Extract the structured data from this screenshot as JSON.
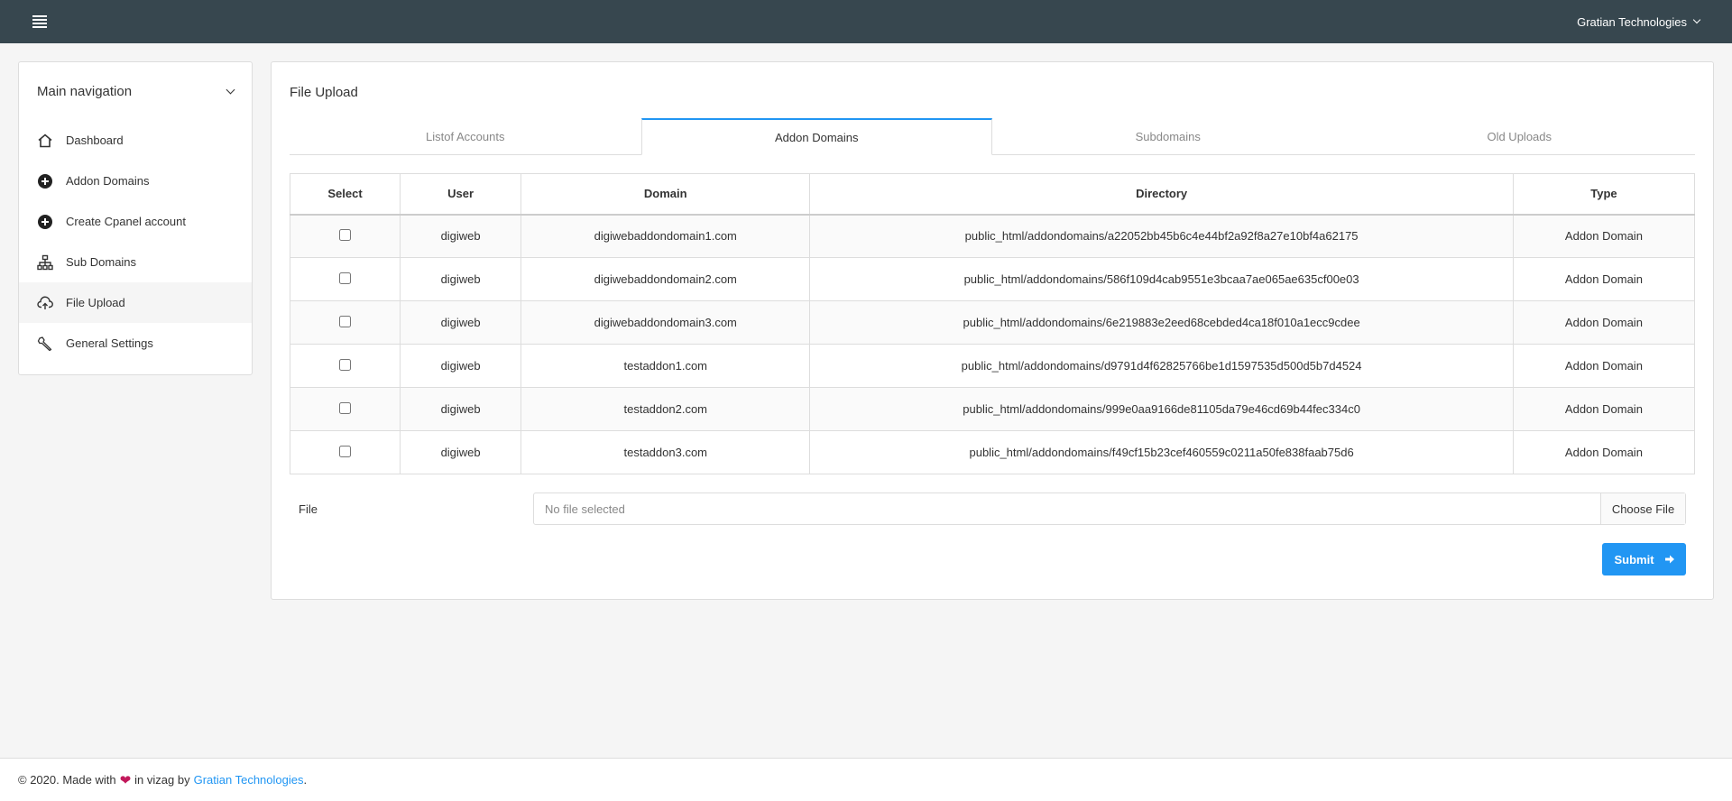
{
  "navbar": {
    "user_name": "Gratian Technologies"
  },
  "sidebar": {
    "header": "Main navigation",
    "items": [
      {
        "label": "Dashboard",
        "icon": "home-icon"
      },
      {
        "label": "Addon Domains",
        "icon": "plus-circle-icon"
      },
      {
        "label": "Create Cpanel account",
        "icon": "plus-circle-icon"
      },
      {
        "label": "Sub Domains",
        "icon": "sitemap-icon"
      },
      {
        "label": "File Upload",
        "icon": "cloud-upload-icon",
        "active": true
      },
      {
        "label": "General Settings",
        "icon": "wrench-icon"
      }
    ]
  },
  "main": {
    "title": "File Upload",
    "tabs": [
      {
        "label": "Listof Accounts"
      },
      {
        "label": "Addon Domains",
        "active": true
      },
      {
        "label": "Subdomains"
      },
      {
        "label": "Old Uploads"
      }
    ],
    "table": {
      "headers": [
        "Select",
        "User",
        "Domain",
        "Directory",
        "Type"
      ],
      "rows": [
        {
          "user": "digiweb",
          "domain": "digiwebaddondomain1.com",
          "directory": "public_html/addondomains/a22052bb45b6c4e44bf2a92f8a27e10bf4a62175",
          "type": "Addon Domain"
        },
        {
          "user": "digiweb",
          "domain": "digiwebaddondomain2.com",
          "directory": "public_html/addondomains/586f109d4cab9551e3bcaa7ae065ae635cf00e03",
          "type": "Addon Domain"
        },
        {
          "user": "digiweb",
          "domain": "digiwebaddondomain3.com",
          "directory": "public_html/addondomains/6e219883e2eed68cebded4ca18f010a1ecc9cdee",
          "type": "Addon Domain"
        },
        {
          "user": "digiweb",
          "domain": "testaddon1.com",
          "directory": "public_html/addondomains/d9791d4f62825766be1d1597535d500d5b7d4524",
          "type": "Addon Domain"
        },
        {
          "user": "digiweb",
          "domain": "testaddon2.com",
          "directory": "public_html/addondomains/999e0aa9166de81105da79e46cd69b44fec334c0",
          "type": "Addon Domain"
        },
        {
          "user": "digiweb",
          "domain": "testaddon3.com",
          "directory": "public_html/addondomains/f49cf15b23cef460559c0211a50fe838faab75d6",
          "type": "Addon Domain"
        }
      ]
    },
    "file": {
      "label": "File",
      "placeholder": "No file selected",
      "choose_label": "Choose File"
    },
    "submit_label": "Submit"
  },
  "footer": {
    "prefix": "© 2020. Made with",
    "middle": "in vizag by",
    "link": "Gratian Technologies",
    "suffix": "."
  },
  "colors": {
    "navbar": "#37474f",
    "accent": "#2196f3",
    "heart": "#c2185b"
  }
}
